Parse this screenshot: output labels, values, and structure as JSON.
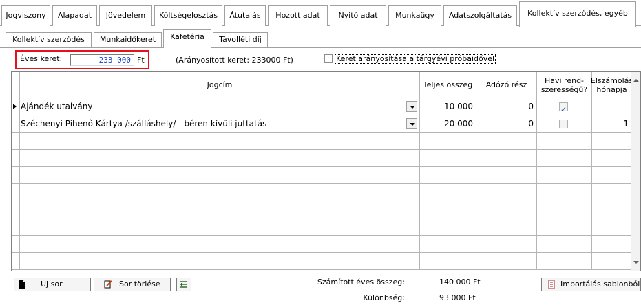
{
  "tabs_main": [
    {
      "label": "Jogviszony"
    },
    {
      "label": "Alapadat"
    },
    {
      "label": "Jövedelem"
    },
    {
      "label": "Költségelosztás"
    },
    {
      "label": "Átutalás"
    },
    {
      "label": "Hozott adat"
    },
    {
      "label": "Nyitó adat"
    },
    {
      "label": "Munkaügy"
    },
    {
      "label": "Adatszolgáltatás"
    },
    {
      "label": "Kollektív szerződés, egyéb"
    }
  ],
  "tabs_sub": [
    {
      "label": "Kollektív szerződés"
    },
    {
      "label": "Munkaidőkeret"
    },
    {
      "label": "Kafetéria"
    },
    {
      "label": "Távolléti díj"
    }
  ],
  "keret": {
    "label": "Éves keret:",
    "value": "233 000",
    "unit": "Ft",
    "aranyositott": "(Arányosított keret: 233000 Ft)",
    "checkbox_label": "Keret arányosítása a tárgyévi próbaidővel",
    "checkbox_checked": false
  },
  "grid": {
    "headers": {
      "jogcim": "Jogcím",
      "teljes": "Teljes összeg",
      "adozo": "Adózó rész",
      "havi": "Havi rend-\nszerességű?",
      "elszamolas": "Elszámolás\nhónapja"
    },
    "rows": [
      {
        "jogcim": "Ajándék utalvány",
        "teljes": "10 000",
        "adozo": "0",
        "havi": true,
        "elszamolas": ""
      },
      {
        "jogcim": "Széchenyi Pihenő Kártya /szálláshely/ - béren kívüli juttatás",
        "teljes": "20 000",
        "adozo": "0",
        "havi": false,
        "elszamolas": "1"
      }
    ]
  },
  "buttons": {
    "uj_sor": "Új sor",
    "sor_torlese": "Sor törlése",
    "importalas": "Importálás sablonból"
  },
  "summary": {
    "szamitott_label": "Számított éves összeg:",
    "szamitott_value": "140 000 Ft",
    "kulonbseg_label": "Különbség:",
    "kulonbseg_value": "93 000 Ft"
  },
  "colors": {
    "highlight_border": "#e8101a",
    "value_text": "#1a3fd6"
  }
}
